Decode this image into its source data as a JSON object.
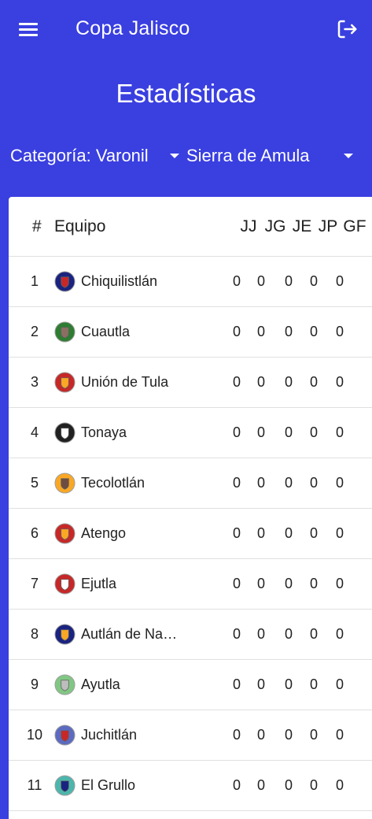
{
  "app": {
    "title": "Copa Jalisco"
  },
  "page": {
    "title": "Estadísticas"
  },
  "filters": {
    "category": "Categoría: Varonil",
    "region": "Sierra de Amula"
  },
  "table": {
    "headers": [
      "#",
      "Equipo",
      "JJ",
      "JG",
      "JE",
      "JP",
      "GF"
    ],
    "rows": [
      {
        "pos": "1",
        "team": "Chiquilistlán",
        "jj": "0",
        "jg": "0",
        "je": "0",
        "jp": "0",
        "gf": "0"
      },
      {
        "pos": "2",
        "team": "Cuautla",
        "jj": "0",
        "jg": "0",
        "je": "0",
        "jp": "0",
        "gf": "0"
      },
      {
        "pos": "3",
        "team": "Unión de Tula",
        "jj": "0",
        "jg": "0",
        "je": "0",
        "jp": "0",
        "gf": "0"
      },
      {
        "pos": "4",
        "team": "Tonaya",
        "jj": "0",
        "jg": "0",
        "je": "0",
        "jp": "0",
        "gf": "0"
      },
      {
        "pos": "5",
        "team": "Tecolotlán",
        "jj": "0",
        "jg": "0",
        "je": "0",
        "jp": "0",
        "gf": "0"
      },
      {
        "pos": "6",
        "team": "Atengo",
        "jj": "0",
        "jg": "0",
        "je": "0",
        "jp": "0",
        "gf": "0"
      },
      {
        "pos": "7",
        "team": "Ejutla",
        "jj": "0",
        "jg": "0",
        "je": "0",
        "jp": "0",
        "gf": "0"
      },
      {
        "pos": "8",
        "team": "Autlán de Na…",
        "jj": "0",
        "jg": "0",
        "je": "0",
        "jp": "0",
        "gf": "0"
      },
      {
        "pos": "9",
        "team": "Ayutla",
        "jj": "0",
        "jg": "0",
        "je": "0",
        "jp": "0",
        "gf": "0"
      },
      {
        "pos": "10",
        "team": "Juchitlán",
        "jj": "0",
        "jg": "0",
        "je": "0",
        "jp": "0",
        "gf": "0"
      },
      {
        "pos": "11",
        "team": "El Grullo",
        "jj": "0",
        "jg": "0",
        "je": "0",
        "jp": "0",
        "gf": "0"
      }
    ]
  },
  "icons": {
    "menu": "menu-icon",
    "logout": "logout-icon",
    "dropdown": "arrow-drop-down-icon"
  },
  "colors": {
    "primary": "#3a3fe0",
    "surface": "#ffffff",
    "divider": "#e0e0e0"
  }
}
